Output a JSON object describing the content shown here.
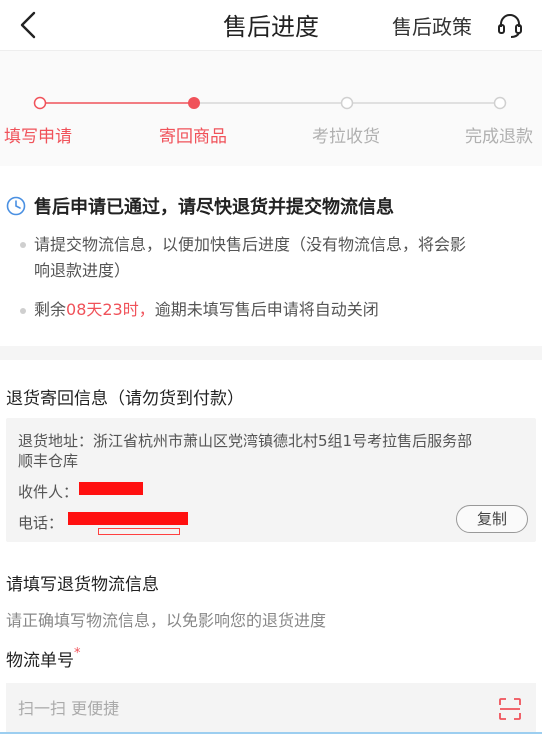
{
  "nav": {
    "title": "售后进度",
    "policy_label": "售后政策"
  },
  "steps": [
    {
      "label": "填写申请",
      "state": "done"
    },
    {
      "label": "寄回商品",
      "state": "current"
    },
    {
      "label": "考拉收货",
      "state": "todo"
    },
    {
      "label": "完成退款",
      "state": "todo"
    }
  ],
  "notice": {
    "headline": "售后申请已通过，请尽快退货并提交物流信息",
    "item1_line1": "请提交物流信息，以便加快售后进度（没有物流信息，将会影",
    "item1_line2": "响退款进度）",
    "item2_prefix": "剩余",
    "item2_highlight": "08天23时，",
    "item2_suffix": "逾期未填写售后申请将自动关闭"
  },
  "return_info": {
    "title": "退货寄回信息（请勿货到付款）",
    "address_line1": "退货地址：浙江省杭州市萧山区党湾镇德北村5组1号考拉售后服务部",
    "address_line2": "顺丰仓库",
    "recipient_label": "收件人：",
    "phone_label": "电话：",
    "copy_label": "复制"
  },
  "logistics": {
    "title": "请填写退货物流信息",
    "subtitle": "请正确填写物流信息，以免影响您的退货进度",
    "tracking_label": "物流单号",
    "required_mark": "*",
    "tracking_placeholder": "扫一扫 更便捷"
  },
  "colors": {
    "accent": "#f0525a",
    "inactive": "#cfcfcf"
  }
}
